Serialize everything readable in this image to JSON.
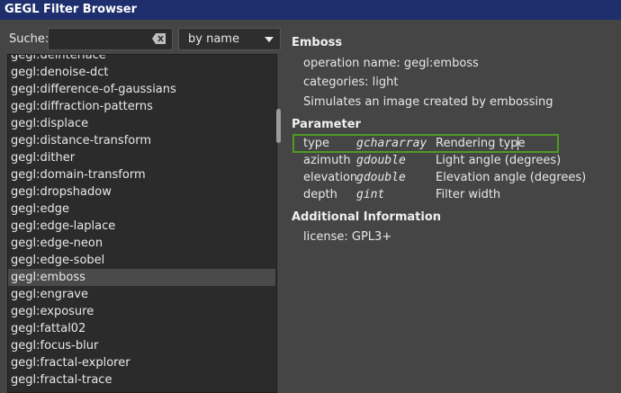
{
  "window": {
    "title": "GEGL Filter Browser"
  },
  "search": {
    "label": "Suche:",
    "value": ""
  },
  "sort": {
    "selected": "by name"
  },
  "filters": [
    "gegl:deinterlace",
    "gegl:denoise-dct",
    "gegl:difference-of-gaussians",
    "gegl:diffraction-patterns",
    "gegl:displace",
    "gegl:distance-transform",
    "gegl:dither",
    "gegl:domain-transform",
    "gegl:dropshadow",
    "gegl:edge",
    "gegl:edge-laplace",
    "gegl:edge-neon",
    "gegl:edge-sobel",
    "gegl:emboss",
    "gegl:engrave",
    "gegl:exposure",
    "gegl:fattal02",
    "gegl:focus-blur",
    "gegl:fractal-explorer",
    "gegl:fractal-trace"
  ],
  "selected_filter": "gegl:emboss",
  "detail": {
    "name": "Emboss",
    "operation": "operation name: gegl:emboss",
    "categories": "categories: light",
    "description": "Simulates an image created by embossing",
    "params_heading": "Parameter",
    "params": [
      {
        "name": "type",
        "type": "gchararray",
        "desc": "Rendering type"
      },
      {
        "name": "azimuth",
        "type": "gdouble",
        "desc": "Light angle (degrees)"
      },
      {
        "name": "elevation",
        "type": "gdouble",
        "desc": "Elevation angle (degrees)"
      },
      {
        "name": "depth",
        "type": "gint",
        "desc": "Filter width"
      }
    ],
    "additional_heading": "Additional Information",
    "license": "license: GPL3+"
  }
}
